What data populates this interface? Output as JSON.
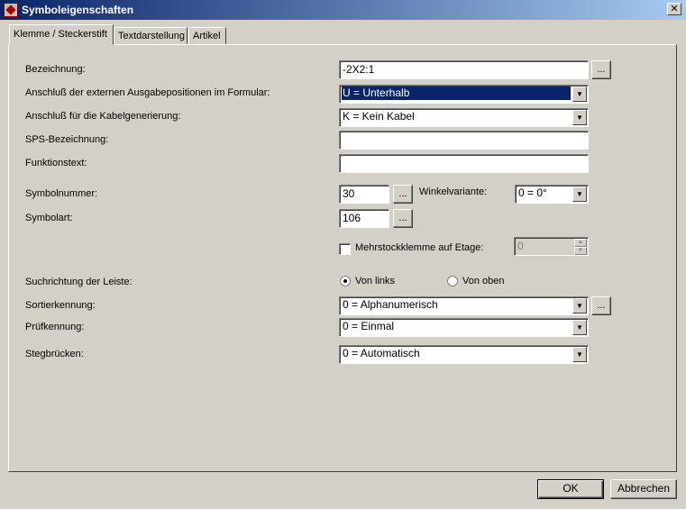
{
  "window": {
    "title": "Symboleigenschaften",
    "close_glyph": "✕"
  },
  "tabs": [
    "Klemme / Steckerstift",
    "Textdarstellung",
    "Artikel"
  ],
  "fields": {
    "bezeichnung": {
      "label": "Bezeichnung:",
      "value": "-2X2:1"
    },
    "anschluss_ausgabe": {
      "label": "Anschluß der externen Ausgabepositionen im Formular:",
      "value": "U = Unterhalb"
    },
    "anschluss_kabel": {
      "label": "Anschluß für die Kabelgenerierung:",
      "value": "K = Kein Kabel"
    },
    "sps_bezeichnung": {
      "label": "SPS-Bezeichnung:",
      "value": ""
    },
    "funktionstext": {
      "label": "Funktionstext:",
      "value": ""
    },
    "symbolnummer": {
      "label": "Symbolnummer:",
      "value": "30"
    },
    "winkelvariante": {
      "label": "Winkelvariante:",
      "value": "0 = 0°"
    },
    "symbolart": {
      "label": "Symbolart:",
      "value": "106"
    },
    "mehrstock": {
      "label": "Mehrstockklemme auf Etage:",
      "checked": false,
      "value": "0"
    },
    "suchrichtung": {
      "label": "Suchrichtung der Leiste:",
      "options": [
        "Von links",
        "Von oben"
      ],
      "selected": "Von links"
    },
    "sortierkennung": {
      "label": "Sortierkennung:",
      "value": "0 = Alphanumerisch"
    },
    "pruefkennung": {
      "label": "Prüfkennung:",
      "value": "0 = Einmal"
    },
    "stegbruecken": {
      "label": "Stegbrücken:",
      "value": "0 = Automatisch"
    }
  },
  "buttons": {
    "dots": "...",
    "ok": "OK",
    "cancel": "Abbrechen"
  },
  "icons": {
    "arrow_down": "▼",
    "spin_up": "▲",
    "spin_down": "▼"
  }
}
